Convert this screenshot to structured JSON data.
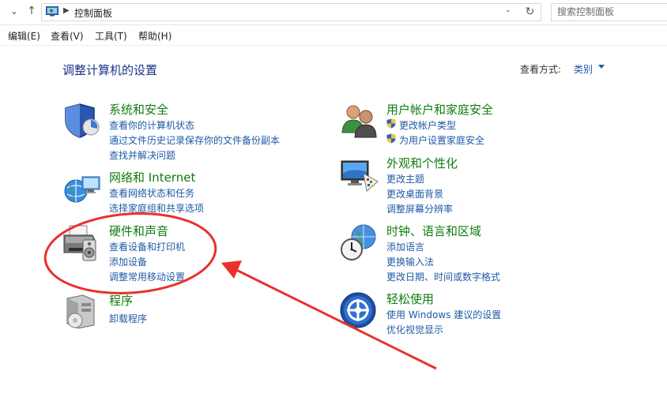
{
  "address_bar": {
    "crumb": "控制面板",
    "search_placeholder": "搜索控制面板"
  },
  "menu": {
    "items": [
      "编辑(E)",
      "查看(V)",
      "工具(T)",
      "帮助(H)"
    ]
  },
  "header": {
    "title": "调整计算机的设置",
    "view_label": "查看方式:",
    "view_value": "类别"
  },
  "categories": {
    "system": {
      "title": "系统和安全",
      "links": [
        "查看你的计算机状态",
        "通过文件历史记录保存你的文件备份副本",
        "查找并解决问题"
      ]
    },
    "network": {
      "title": "网络和 Internet",
      "links": [
        "查看网络状态和任务",
        "选择家庭组和共享选项"
      ]
    },
    "hardware": {
      "title": "硬件和声音",
      "links": [
        "查看设备和打印机",
        "添加设备",
        "调整常用移动设置"
      ]
    },
    "programs": {
      "title": "程序",
      "links": [
        "卸载程序"
      ]
    },
    "users": {
      "title": "用户帐户和家庭安全",
      "links": [
        "更改帐户类型",
        "为用户设置家庭安全"
      ]
    },
    "appearance": {
      "title": "外观和个性化",
      "links": [
        "更改主题",
        "更改桌面背景",
        "调整屏幕分辨率"
      ]
    },
    "clock": {
      "title": "时钟、语言和区域",
      "links": [
        "添加语言",
        "更换输入法",
        "更改日期、时间或数字格式"
      ]
    },
    "ease": {
      "title": "轻松使用",
      "links": [
        "使用 Windows 建议的设置",
        "优化视觉显示"
      ]
    }
  },
  "colors": {
    "category_title": "#107c10",
    "link": "#1e5aa6",
    "page_title": "#1e3287",
    "annotation": "#e8322b"
  }
}
